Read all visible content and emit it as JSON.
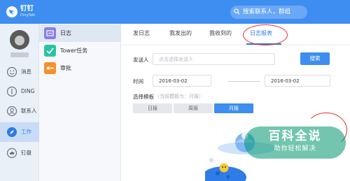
{
  "app": {
    "name": "钉钉",
    "sub": "DingTalk",
    "search_placeholder": "搜索联系人，群组"
  },
  "rail": {
    "items": [
      {
        "label": "消息",
        "icon": "smile-icon"
      },
      {
        "label": "DING",
        "icon": "ding-icon"
      },
      {
        "label": "联系人",
        "icon": "contact-icon"
      },
      {
        "label": "工作",
        "icon": "work-icon",
        "active": true
      },
      {
        "label": "钉盘",
        "icon": "cloud-disk-icon"
      }
    ]
  },
  "apps": {
    "items": [
      {
        "label": "日志",
        "icon": "log-icon",
        "color": "#8a7de8",
        "active": true
      },
      {
        "label": "Tower任务",
        "icon": "check-icon",
        "color": "#2bc4a2"
      },
      {
        "label": "审批",
        "icon": "approve-icon",
        "color": "#f5902a"
      }
    ]
  },
  "tabs": [
    {
      "label": "发日志"
    },
    {
      "label": "我发出的"
    },
    {
      "label": "我收到的"
    },
    {
      "label": "日志报表",
      "active": true
    }
  ],
  "form": {
    "sender_label": "发送人",
    "sender_placeholder": "点击选择发送人",
    "search_button": "搜索",
    "time_label": "时间",
    "start_date": "2016-03-02",
    "end_date": "2016-03-02",
    "template_label": "选择模板",
    "template_hint": "（当前模板为：月报）",
    "templates": [
      {
        "label": "日报"
      },
      {
        "label": "周报"
      },
      {
        "label": "月报",
        "active": true
      }
    ]
  },
  "watermark": {
    "title": "百科全说",
    "subtitle": "助你轻松解决"
  },
  "colors": {
    "accent": "#3d8ef0",
    "annotation": "#e8332d"
  }
}
